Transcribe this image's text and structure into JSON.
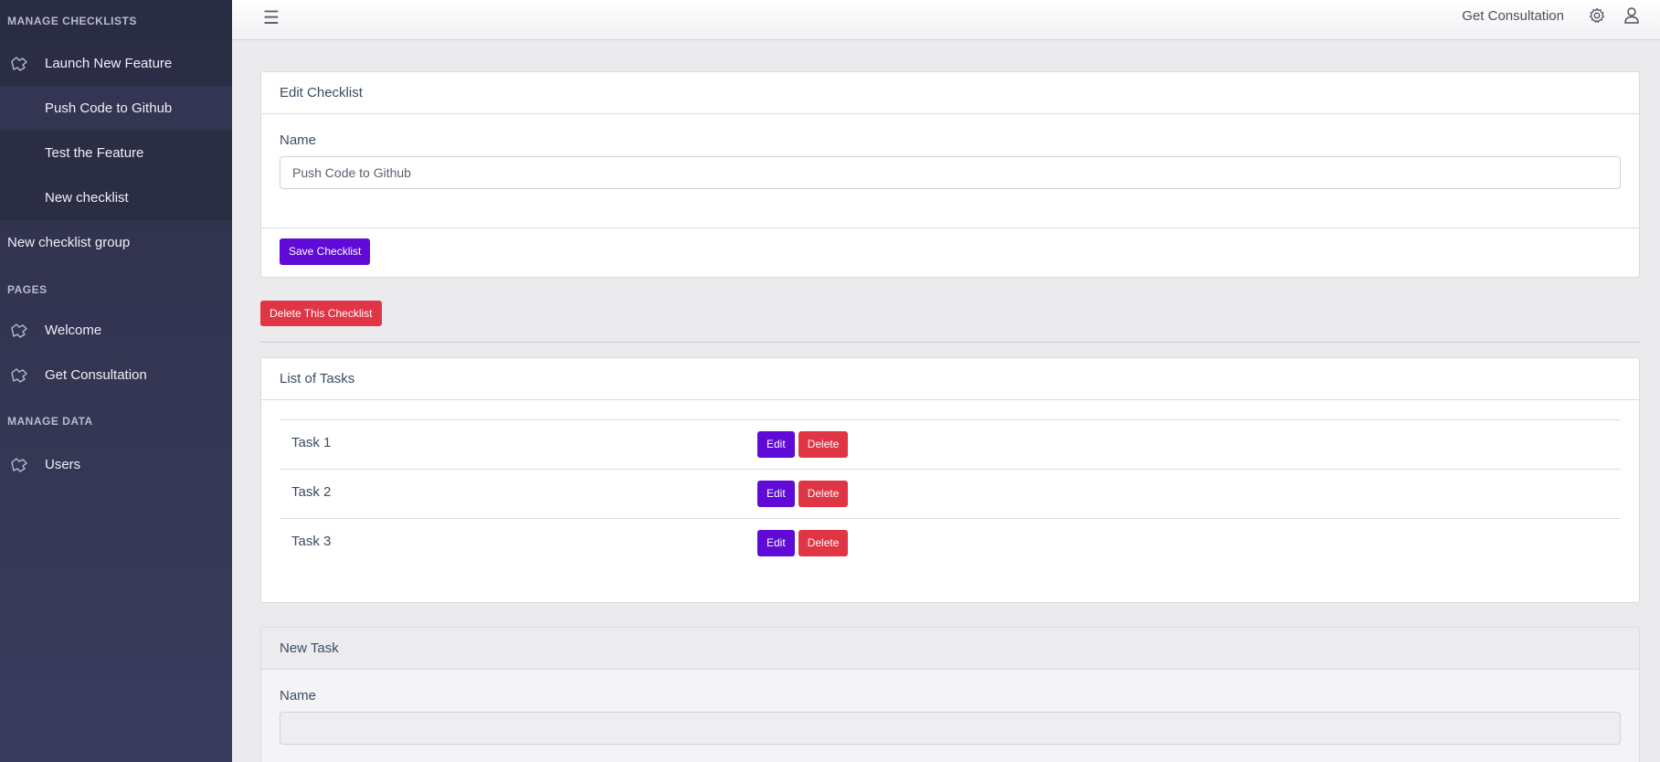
{
  "sidebar": {
    "sections": [
      {
        "title": "MANAGE CHECKLISTS"
      },
      {
        "title": "PAGES"
      },
      {
        "title": "MANAGE DATA"
      }
    ],
    "checklist_group": "Launch New Feature",
    "checklists": [
      "Push Code to Github",
      "Test the Feature",
      "New checklist"
    ],
    "new_group": "New checklist group",
    "pages": [
      "Welcome",
      "Get Consultation"
    ],
    "data": [
      "Users"
    ]
  },
  "topbar": {
    "menu_icon": "hamburger-icon",
    "link": "Get Consultation",
    "settings_icon": "gear-icon",
    "user_icon": "user-icon"
  },
  "edit_card": {
    "title": "Edit Checklist",
    "name_label": "Name",
    "name_value": "Push Code to Github",
    "save_label": "Save Checklist"
  },
  "delete_label": "Delete This Checklist",
  "tasks_card": {
    "title": "List of Tasks",
    "edit_label": "Edit",
    "delete_label": "Delete",
    "tasks": [
      "Task 1",
      "Task 2",
      "Task 3"
    ]
  },
  "new_task_card": {
    "title": "New Task",
    "name_label": "Name",
    "name_value": ""
  },
  "colors": {
    "primary": "#5f0ad6",
    "danger": "#e03544",
    "sidebar": "#2d2f48"
  }
}
